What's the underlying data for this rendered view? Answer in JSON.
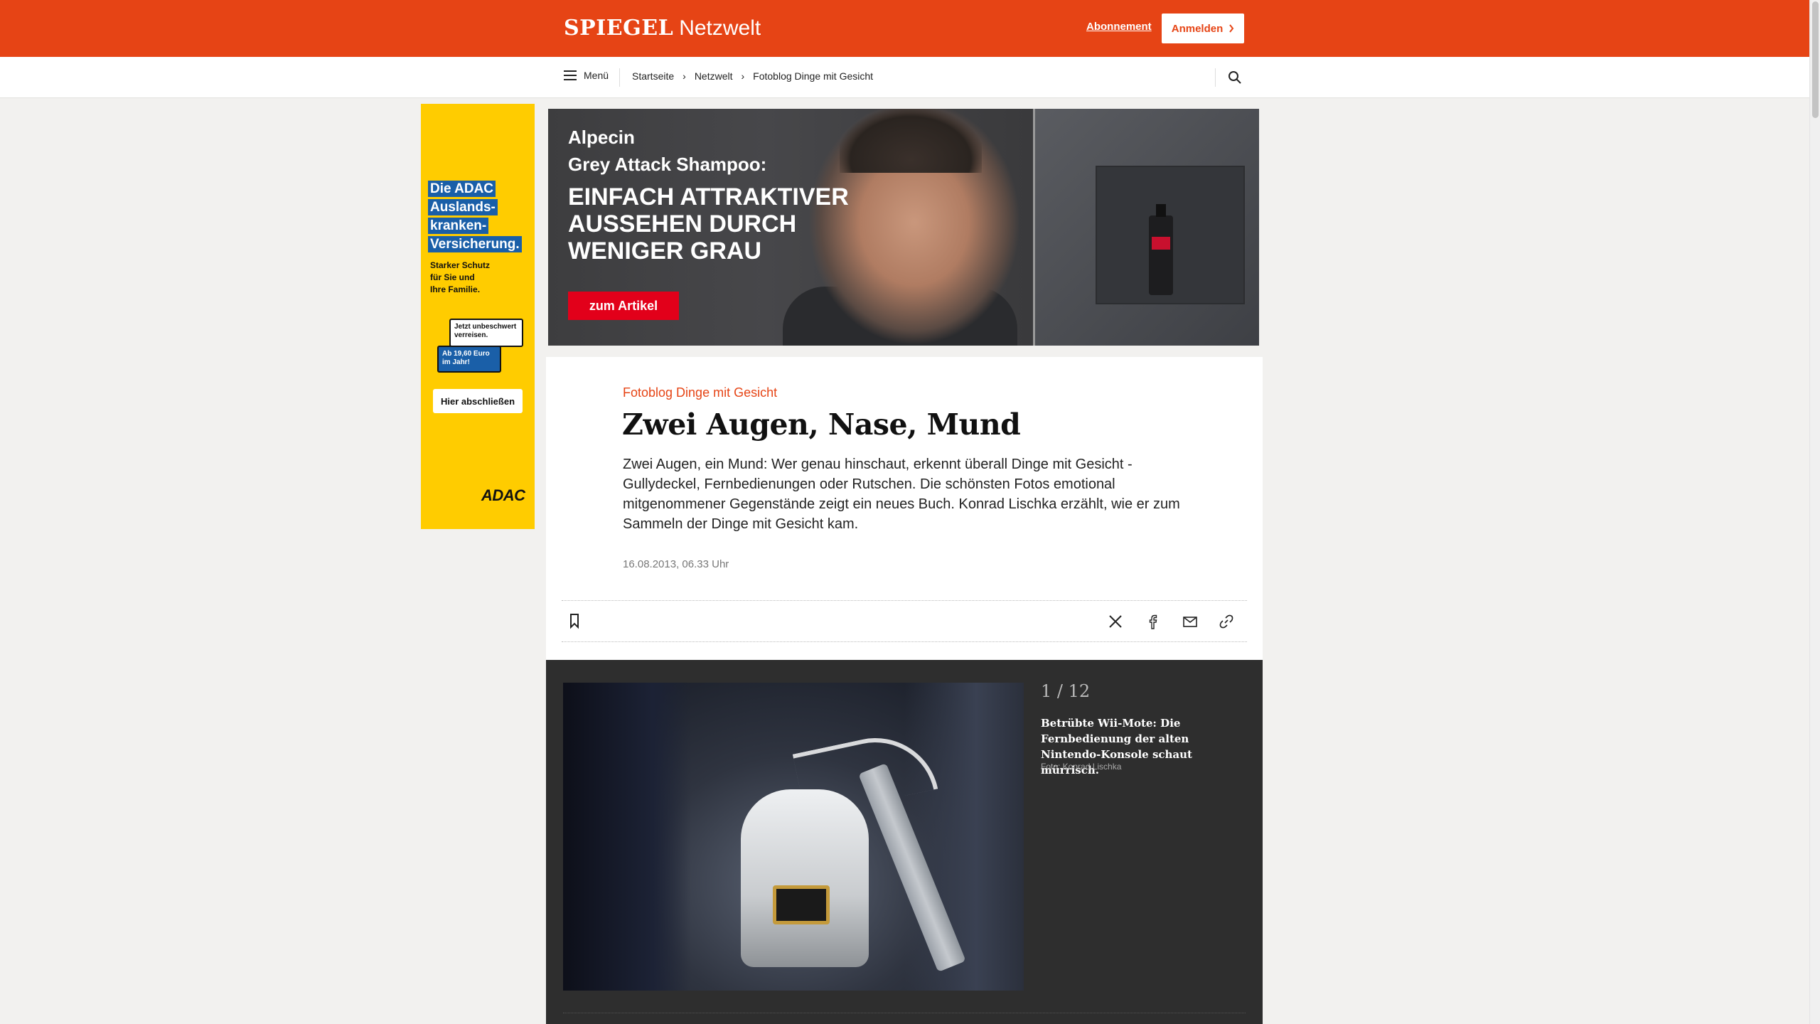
{
  "header": {
    "brand_main": "SPIEGEL",
    "brand_section": "Netzwelt",
    "subscription_link": "Abonnement",
    "login_button": "Anmelden",
    "brand_color": "#e64415"
  },
  "nav": {
    "menu_label": "Menü",
    "breadcrumb": [
      "Startseite",
      "Netzwelt",
      "Fotoblog Dinge mit Gesicht"
    ],
    "search_icon": "search-icon"
  },
  "ad_left": {
    "headline_lines": [
      "Die ADAC",
      "Auslands-",
      "kranken-",
      "Versicherung."
    ],
    "subline": "Starker Schutz\nfür Sie und\nIhre Familie.",
    "bubble_1": "Jetzt unbeschwert verreisen.",
    "bubble_2": "Ab 19,60 Euro im Jahr!",
    "cta": "Hier abschließen",
    "logo": "ADAC"
  },
  "ad_banner": {
    "brand": "Alpecin",
    "product": "Grey Attack Shampoo:",
    "claim": "EINFACH ATTRAKTIVER\nAUSSEHEN DURCH\nWENIGER GRAU",
    "cta": "zum Artikel"
  },
  "article": {
    "kicker": "Fotoblog Dinge mit Gesicht",
    "headline": "Zwei Augen, Nase, Mund",
    "teaser": "Zwei Augen, ein Mund: Wer genau hinschaut, erkennt überall Dinge mit Gesicht - Gullydeckel, Fernbedienungen oder Rutschen. Die schönsten Fotos emotional mitgenommener Gegenstände zeigt ein neues Buch. Konrad Lischka erzählt, wie er zum Sammeln der Dinge mit Gesicht kam.",
    "date": "16.08.2013, 06.33 Uhr",
    "share_icons": [
      "x-icon",
      "facebook-icon",
      "mail-icon",
      "link-icon"
    ]
  },
  "gallery": {
    "counter": "1 / 12",
    "caption": "Betrübte Wii-Mote: Die Fernbedienung der alten Nintendo-Konsole schaut mürrisch.",
    "credit": "Foto: Konrad Lischka"
  }
}
